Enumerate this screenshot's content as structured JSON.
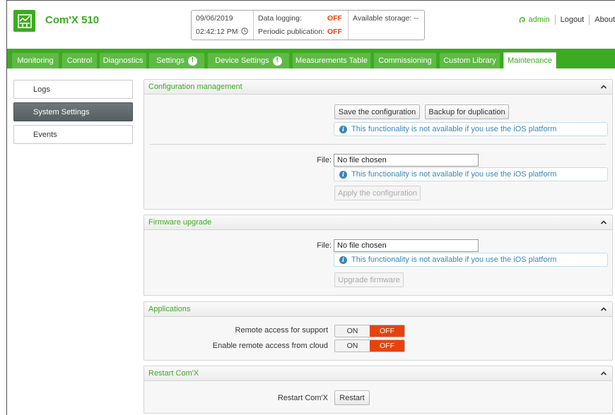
{
  "app": {
    "title": "Com'X 510"
  },
  "status": {
    "date": "09/06/2019",
    "time": "02:42:12 PM",
    "data_logging_label": "Data logging:",
    "data_logging_value": "OFF",
    "periodic_label": "Periodic publication:",
    "periodic_value": "OFF",
    "storage_label": "Available storage: --"
  },
  "user": {
    "name": "admin",
    "logout": "Logout",
    "about": "About"
  },
  "nav": {
    "tabs": [
      {
        "label": "Monitoring"
      },
      {
        "label": "Control"
      },
      {
        "label": "Diagnostics"
      },
      {
        "label": "Settings"
      },
      {
        "label": "Device Settings"
      },
      {
        "label": "Measurements Table"
      },
      {
        "label": "Commissioning"
      },
      {
        "label": "Custom Library"
      },
      {
        "label": "Maintenance"
      }
    ],
    "active": "Maintenance"
  },
  "sidebar": {
    "items": [
      {
        "label": "Logs"
      },
      {
        "label": "System Settings"
      },
      {
        "label": "Events"
      }
    ],
    "active": "System Settings"
  },
  "config": {
    "title": "Configuration management",
    "save_btn": "Save the configuration",
    "backup_btn": "Backup for duplication",
    "info": "This functionality is not available if you use the iOS platform",
    "file_label": "File:",
    "file_value": "No file chosen",
    "info2": "This functionality is not available if you use the iOS platform",
    "apply_btn": "Apply the configuration"
  },
  "firmware": {
    "title": "Firmware upgrade",
    "file_label": "File:",
    "file_value": "No file chosen",
    "info": "This functionality is not available if you use the iOS platform",
    "upgrade_btn": "Upgrade firmware"
  },
  "applications": {
    "title": "Applications",
    "remote_support_label": "Remote access for support",
    "remote_cloud_label": "Enable remote access from cloud",
    "on": "ON",
    "off": "OFF"
  },
  "restart": {
    "title": "Restart Com'X",
    "label": "Restart Com'X",
    "btn": "Restart"
  },
  "colors": {
    "brand": "#3dab21",
    "off": "#e8420c",
    "info": "#3a86b4"
  }
}
